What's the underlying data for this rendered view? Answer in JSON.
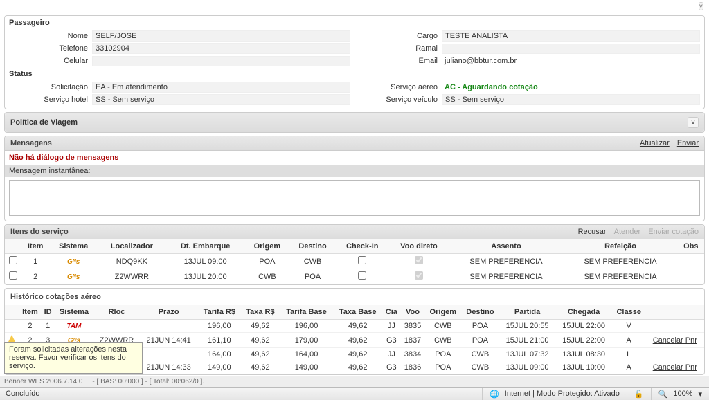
{
  "passenger": {
    "section_title": "Passageiro",
    "name_label": "Nome",
    "name": "SELF/JOSE",
    "phone_label": "Telefone",
    "phone": "33102904",
    "cell_label": "Celular",
    "cell": "",
    "role_label": "Cargo",
    "role": "TESTE ANALISTA",
    "ext_label": "Ramal",
    "ext": "",
    "email_label": "Email",
    "email": "juliano@bbtur.com.br"
  },
  "status": {
    "section_title": "Status",
    "req_label": "Solicitação",
    "req": "EA - Em atendimento",
    "hotel_label": "Serviço hotel",
    "hotel": "SS - Sem serviço",
    "air_label": "Serviço aéreo",
    "air": "AC - Aguardando cotação",
    "vehicle_label": "Serviço veículo",
    "vehicle": "SS - Sem serviço"
  },
  "policy": {
    "title": "Política de Viagem"
  },
  "messages": {
    "title": "Mensagens",
    "update": "Atualizar",
    "send": "Enviar",
    "no_dialog": "Não há diálogo de mensagens",
    "instant_label": "Mensagem instantânea:"
  },
  "items": {
    "title": "Itens do serviço",
    "actions": {
      "refuse": "Recusar",
      "attend": "Atender",
      "send_quote": "Enviar cotação"
    },
    "headers": [
      "Item",
      "Sistema",
      "Localizador",
      "Dt. Embarque",
      "Origem",
      "Destino",
      "Check-In",
      "Voo direto",
      "Assento",
      "Refeição",
      "Obs"
    ],
    "rows": [
      {
        "item": "1",
        "sys": "gol",
        "loc": "NDQ9KK",
        "dt": "13JUL 09:00",
        "orig": "POA",
        "dest": "CWB",
        "checkin": false,
        "direct": true,
        "seat": "SEM PREFERENCIA",
        "meal": "SEM PREFERENCIA",
        "obs": ""
      },
      {
        "item": "2",
        "sys": "gol",
        "loc": "Z2WWRR",
        "dt": "13JUL 20:00",
        "orig": "CWB",
        "dest": "POA",
        "checkin": false,
        "direct": true,
        "seat": "SEM PREFERENCIA",
        "meal": "SEM PREFERENCIA",
        "obs": ""
      }
    ]
  },
  "history": {
    "title": "Histórico cotações aéreo",
    "headers": [
      "Item",
      "ID",
      "Sistema",
      "Rloc",
      "Prazo",
      "Tarifa R$",
      "Taxa R$",
      "Tarifa Base",
      "Taxa Base",
      "Cia",
      "Voo",
      "Origem",
      "Destino",
      "Partida",
      "Chegada",
      "Classe",
      ""
    ],
    "cancel_label": "Cancelar Pnr",
    "rows": [
      {
        "warn": false,
        "item": "2",
        "id": "1",
        "sys": "tam",
        "rloc": "",
        "prazo": "",
        "tarifa": "196,00",
        "taxa": "49,62",
        "tarifab": "196,00",
        "taxab": "49,62",
        "cia": "JJ",
        "voo": "3835",
        "orig": "CWB",
        "dest": "POA",
        "partida": "15JUL 20:55",
        "chegada": "15JUL 22:00",
        "classe": "V",
        "cancel": false
      },
      {
        "warn": true,
        "item": "2",
        "id": "3",
        "sys": "gol",
        "rloc": "Z2WWRR",
        "prazo": "21JUN 14:41",
        "tarifa": "161,10",
        "taxa": "49,62",
        "tarifab": "179,00",
        "taxab": "49,62",
        "cia": "G3",
        "voo": "1837",
        "orig": "CWB",
        "dest": "POA",
        "partida": "15JUL 21:00",
        "chegada": "15JUL 22:00",
        "classe": "A",
        "cancel": true
      },
      {
        "warn": false,
        "item": "",
        "id": "",
        "sys": "",
        "rloc": "",
        "prazo": "",
        "tarifa": "164,00",
        "taxa": "49,62",
        "tarifab": "164,00",
        "taxab": "49,62",
        "cia": "JJ",
        "voo": "3834",
        "orig": "POA",
        "dest": "CWB",
        "partida": "13JUL 07:32",
        "chegada": "13JUL 08:30",
        "classe": "L",
        "cancel": false
      },
      {
        "warn": false,
        "item": "",
        "id": "",
        "sys": "",
        "rloc": "",
        "prazo": "21JUN 14:33",
        "tarifa": "149,00",
        "taxa": "49,62",
        "tarifab": "149,00",
        "taxab": "49,62",
        "cia": "G3",
        "voo": "1836",
        "orig": "POA",
        "dest": "CWB",
        "partida": "13JUL 09:00",
        "chegada": "13JUL 10:00",
        "classe": "A",
        "cancel": true
      }
    ]
  },
  "tooltip": "Foram solicitadas alterações nesta reserva. Favor verificar os itens do serviço.",
  "statusbar": {
    "app": "Benner WES 2006.7.14.0",
    "timing": "- [ BAS: 00:000 ] - [ Total: 00:062/0 ]."
  },
  "browser": {
    "done": "Concluído",
    "internet": "Internet | Modo Protegido: Ativado",
    "zoom": "100%"
  }
}
